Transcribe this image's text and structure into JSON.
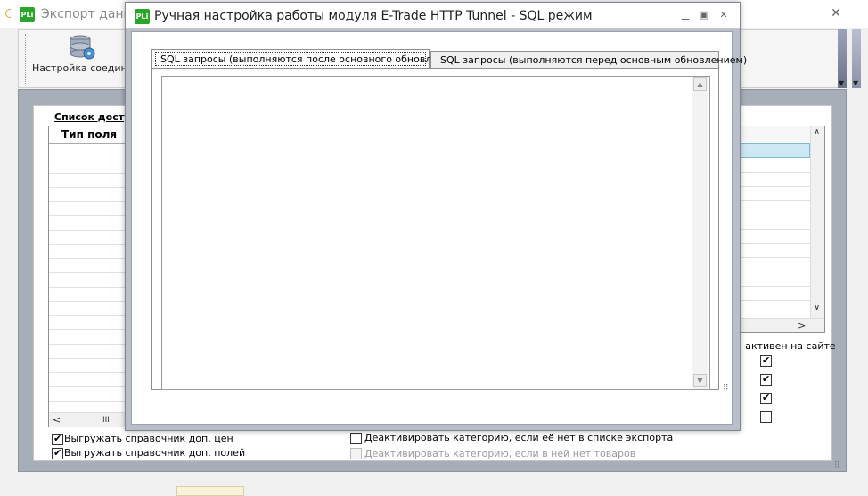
{
  "main_window": {
    "title": "Экспорт данны",
    "close": "✕",
    "logo": "PLi",
    "ribbon": {
      "connection_button_label": "Настройка соедине",
      "connection_icon": "database-gear-icon"
    },
    "list_title": "Список досту",
    "field_type_header": "Тип поля",
    "active_on_site_label": "о активен на сайте",
    "active_checkboxes": [
      true,
      true,
      true,
      false
    ],
    "export_price_lists_label": "Выгружать справочник доп. цен",
    "export_price_lists_checked": true,
    "export_extra_fields_label": "Выгружать справочник доп. полей",
    "export_extra_fields_checked": true,
    "deactivate_not_in_export_label": "Деактивировать категорию, если её нет в списке экспорта",
    "deactivate_not_in_export_checked": false,
    "deactivate_empty_label": "Деактивировать категорию, если в ней нет товаров",
    "deactivate_empty_checked": false,
    "hscroll_thumb": "III"
  },
  "dialog": {
    "logo": "PLi",
    "title": "Ручная настройка работы модуля E-Trade HTTP Tunnel - SQL режим",
    "tabs": [
      {
        "label": "SQL запросы (выполняются после основного обновления)",
        "active": true
      },
      {
        "label": "SQL запросы (выполняются перед основным обновлением)",
        "active": false
      }
    ],
    "sql_text": ""
  },
  "colors": {
    "logo_green": "#2aa52a",
    "selected_row": "#cce8f4",
    "dialog_frame": "#b9bec8"
  }
}
